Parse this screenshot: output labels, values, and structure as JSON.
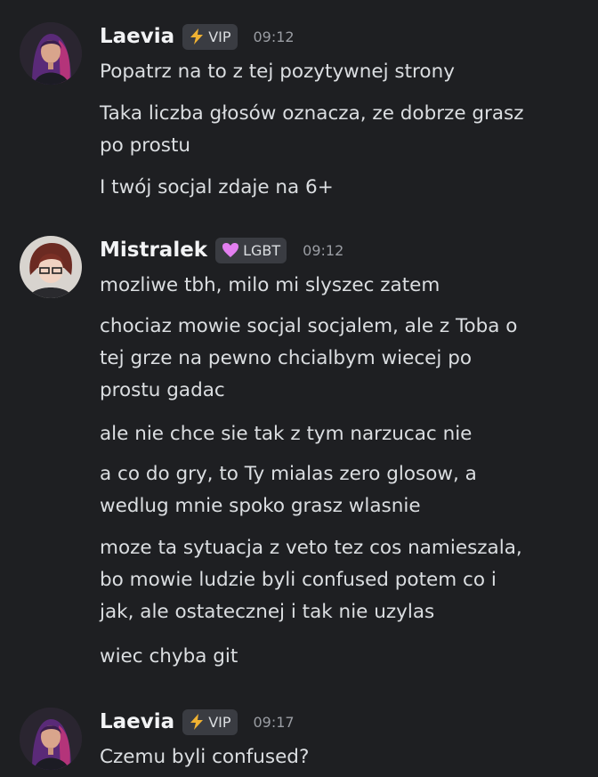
{
  "messages": [
    {
      "author": "Laevia",
      "badge": {
        "icon": "lightning-icon",
        "label": "VIP"
      },
      "time": "09:12",
      "lines": [
        [
          "Popatrz na to z tej pozytywnej strony"
        ],
        [
          "Taka liczba głosów oznacza, ze dobrze grasz",
          "po prostu"
        ],
        [
          "I twój socjal zdaje na 6+"
        ]
      ]
    },
    {
      "author": "Mistralek",
      "badge": {
        "icon": "pink-heart-icon",
        "label": "LGBT"
      },
      "time": "09:12",
      "lines": [
        [
          "mozliwe tbh, milo mi slyszec zatem"
        ],
        [
          "chociaz mowie socjal socjalem, ale z Toba o",
          "tej grze na pewno chcialbym wiecej po",
          "prostu gadac"
        ],
        [
          "ale nie chce sie tak z tym narzucac nie"
        ],
        [
          "a co do gry, to Ty mialas zero glosow, a",
          "wedlug mnie spoko grasz wlasnie"
        ],
        [
          "moze ta sytuacja z veto tez cos namieszala,",
          "bo mowie ludzie byli confused potem co i",
          "jak, ale ostatecznej i tak nie uzylas"
        ],
        [
          "wiec chyba git"
        ]
      ]
    },
    {
      "author": "Laevia",
      "badge": {
        "icon": "lightning-icon",
        "label": "VIP"
      },
      "time": "09:17",
      "lines": [
        [
          "Czemu byli confused?"
        ]
      ]
    }
  ],
  "colors": {
    "background": "#1e1f22",
    "text": "#dbdee1",
    "username": "#f2f3f5",
    "timestamp": "#9a9da3",
    "badge_bg": "#3a3c42",
    "lightning": "#f0b232",
    "heart": "#e37ff0"
  }
}
